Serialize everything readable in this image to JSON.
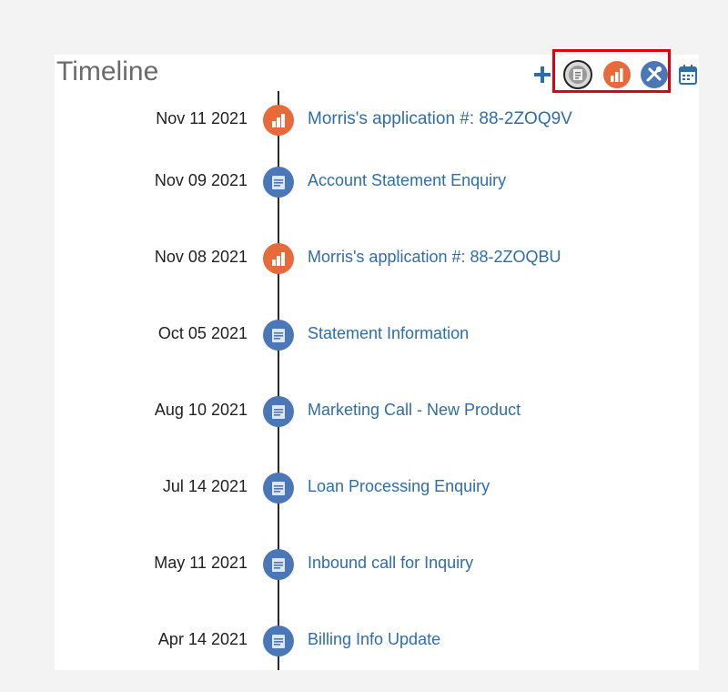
{
  "header": {
    "title": "Timeline",
    "toolbar": [
      {
        "name": "add-icon",
        "kind": "add"
      },
      {
        "name": "all-activities-filter-icon",
        "kind": "grey"
      },
      {
        "name": "opportunity-filter-icon",
        "kind": "orange"
      },
      {
        "name": "service-request-filter-icon",
        "kind": "blue"
      },
      {
        "name": "calendar-icon",
        "kind": "calendar"
      }
    ]
  },
  "colors": {
    "link": "#2d6ea8",
    "orange": "#e66a3a",
    "blue": "#4c77b6",
    "highlight": "#e0000b"
  },
  "events": [
    {
      "date": "Nov 11 2021",
      "label": "Morris's application #: 88-2ZOQ9V",
      "icon": "opportunity-icon"
    },
    {
      "date": "Nov 09 2021",
      "label": "Account Statement Enquiry",
      "icon": "activity-icon"
    },
    {
      "date": "Nov 08 2021",
      "label": "Morris's application #: 88-2ZOQBU",
      "icon": "opportunity-icon"
    },
    {
      "date": "Oct 05 2021",
      "label": "Statement Information",
      "icon": "activity-icon"
    },
    {
      "date": "Aug 10 2021",
      "label": "Marketing Call - New Product",
      "icon": "activity-icon"
    },
    {
      "date": "Jul 14 2021",
      "label": "Loan Processing Enquiry",
      "icon": "activity-icon"
    },
    {
      "date": "May 11 2021",
      "label": "Inbound call for Inquiry",
      "icon": "activity-icon"
    },
    {
      "date": "Apr 14 2021",
      "label": "Billing Info Update",
      "icon": "activity-icon"
    }
  ]
}
